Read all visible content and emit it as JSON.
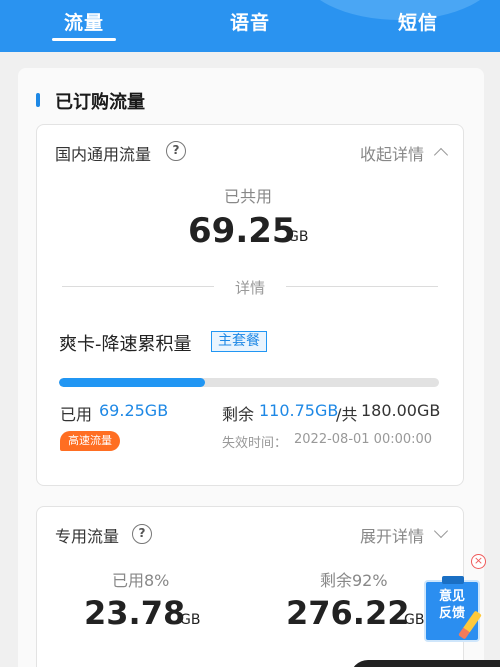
{
  "tabs": [
    {
      "label": "流量",
      "active": true
    },
    {
      "label": "语音",
      "active": false
    },
    {
      "label": "短信",
      "active": false
    }
  ],
  "subscribed": {
    "title": "已订购流量",
    "domestic": {
      "label": "国内通用流量",
      "help": "?",
      "toggle_label": "收起详情",
      "shared_label": "已共用",
      "shared_value": "69.25",
      "shared_unit": "GB",
      "detail_label": "详情",
      "package": {
        "name": "爽卡-降速累积量",
        "tag": "主套餐",
        "used_label": "已用",
        "used_value": "69.25GB",
        "remain_label": "剩余",
        "remain_value": "110.75GB",
        "total_sep": "/共",
        "total_value": "180.00GB",
        "used_fraction": 0.385,
        "speed_badge": "高速流量",
        "expire_label": "失效时间：",
        "expire_value": "2022-08-01 00:00:00"
      }
    },
    "dedicated": {
      "label": "专用流量",
      "help": "?",
      "toggle_label": "展开详情",
      "used_label": "已用8%",
      "used_value": "23.78",
      "used_unit": "GB",
      "remain_label": "剩余92%",
      "remain_value": "276.22",
      "remain_unit": "GB"
    }
  },
  "feedback": {
    "line1": "意见",
    "line2": "反馈",
    "close": "×"
  },
  "colors": {
    "primary": "#2a93f0",
    "accent": "#1e88e5",
    "badge": "#ff6e22"
  }
}
